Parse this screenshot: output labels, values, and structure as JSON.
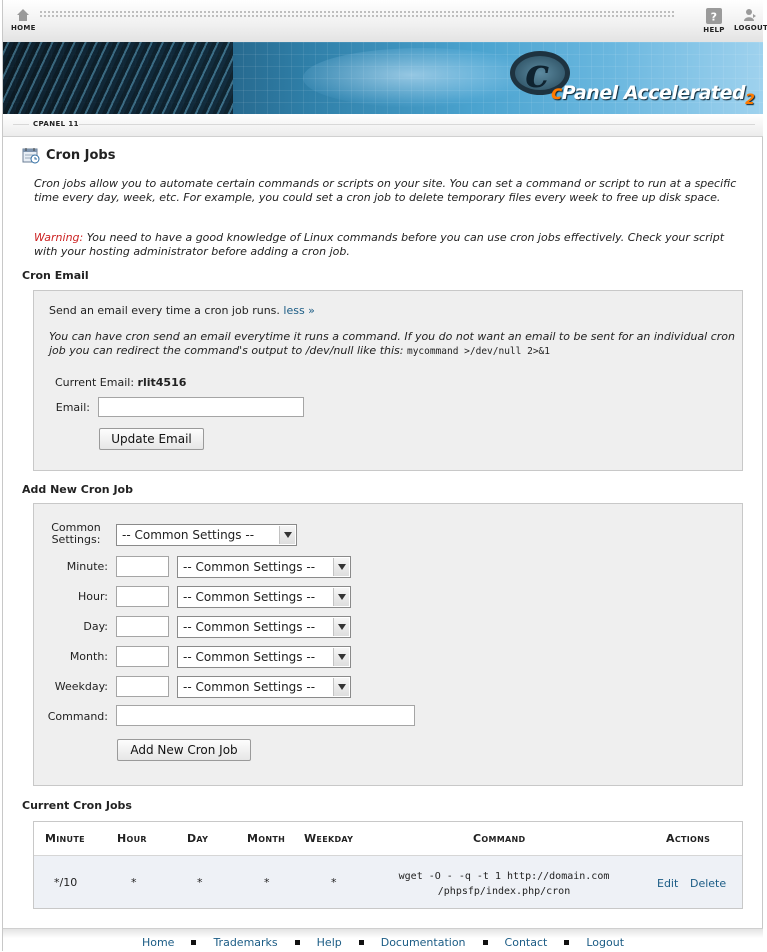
{
  "topnav": {
    "home_label": "HOME",
    "help_label": "HELP",
    "logout_label": "LOGOUT"
  },
  "banner": {
    "logo_c": "c",
    "logo_word": "Panel",
    "logo_accel": "Accelerated",
    "logo_version": "2"
  },
  "breadcrumb": "CPANEL 11",
  "page": {
    "title": "Cron Jobs",
    "intro": "Cron jobs allow you to automate certain commands or scripts on your site. You can set a command or script to run at a specific time every day, week, etc. For example, you could set a cron job to delete temporary files every week to free up disk space.",
    "warning_label": "Warning:",
    "warning_text": " You need to have a good knowledge of Linux commands before you can use cron jobs effectively. Check your script with your hosting administrator before adding a cron job."
  },
  "cron_email": {
    "heading": "Cron Email",
    "send_text": "Send an email every time a cron job runs.",
    "less_link": "less »",
    "info_text": "You can have cron send an email everytime it runs a command. If you do not want an email to be sent for an individual cron job you can redirect the command's output to /dev/null like this:",
    "info_code": "mycommand >/dev/null 2>&1",
    "current_email_label": "Current Email:",
    "current_email_value": "rlit4516",
    "email_label": "Email:",
    "email_value": "",
    "update_button": "Update Email"
  },
  "add_job": {
    "heading": "Add New Cron Job",
    "common_label_1": "Common",
    "common_label_2": "Settings:",
    "common_select": "-- Common Settings --",
    "fields": [
      {
        "label": "Minute:",
        "value": "",
        "select": "-- Common Settings --"
      },
      {
        "label": "Hour:",
        "value": "",
        "select": "-- Common Settings --"
      },
      {
        "label": "Day:",
        "value": "",
        "select": "-- Common Settings --"
      },
      {
        "label": "Month:",
        "value": "",
        "select": "-- Common Settings --"
      },
      {
        "label": "Weekday:",
        "value": "",
        "select": "-- Common Settings --"
      }
    ],
    "command_label": "Command:",
    "command_value": "",
    "add_button": "Add New Cron Job"
  },
  "current_jobs": {
    "heading": "Current Cron Jobs",
    "columns": [
      "Minute",
      "Hour",
      "Day",
      "Month",
      "Weekday",
      "Command",
      "Actions"
    ],
    "rows": [
      {
        "minute": "*/10",
        "hour": "*",
        "day": "*",
        "month": "*",
        "weekday": "*",
        "command_line1": "wget -O - -q -t 1 http://domain.com",
        "command_line2": "/phpsfp/index.php/cron",
        "edit": "Edit",
        "delete": "Delete"
      }
    ]
  },
  "footer": {
    "links": [
      "Home",
      "Trademarks",
      "Help",
      "Documentation",
      "Contact",
      "Logout"
    ]
  },
  "colors": {
    "link": "#1b5c85",
    "warning": "#cc2222",
    "panel_bg": "#efefef",
    "brand_orange": "#ff7a00"
  }
}
